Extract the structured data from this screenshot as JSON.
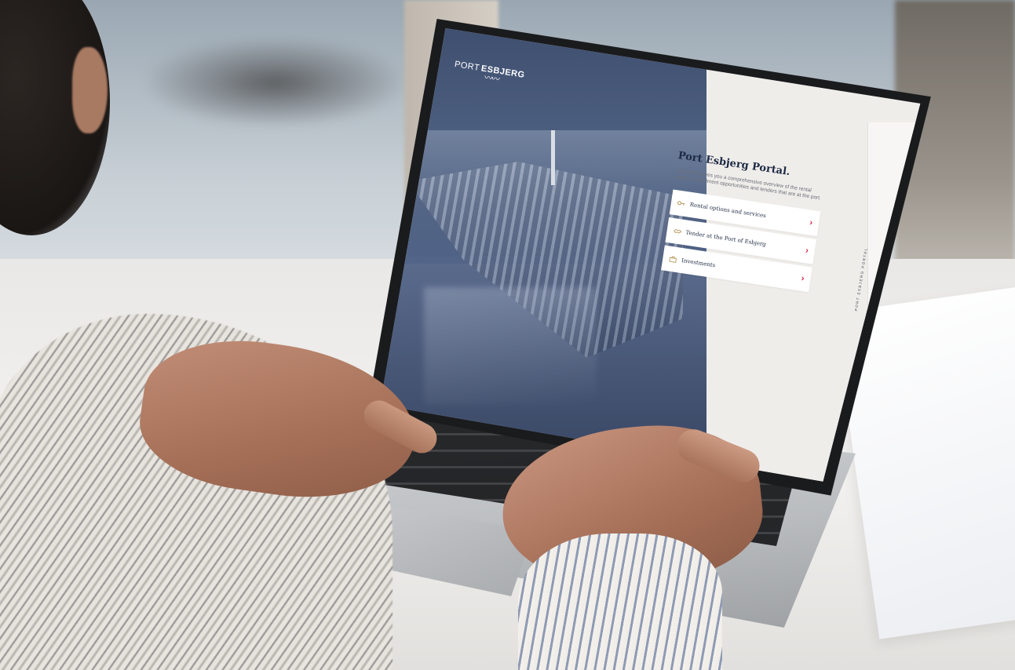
{
  "brand": {
    "word_light": "PORT",
    "word_bold": "ESBJERG"
  },
  "portal": {
    "title": "Port Esbjerg Portal.",
    "description": "This portal gives you a comprehensive overview of the rental options, investment opportunities and tenders that are at the port."
  },
  "menu": {
    "items": [
      {
        "label": "Rental options and services",
        "icon": "key-icon"
      },
      {
        "label": "Tender at the Port of Esbjerg",
        "icon": "handshake-icon"
      },
      {
        "label": "Investments",
        "icon": "briefcase-icon"
      }
    ],
    "chevron": "›"
  },
  "side_label": "PORT ESBJERG PORTAL",
  "colors": {
    "hero_blue": "#4a5b7d",
    "accent_red": "#d7264a",
    "icon_gold": "#b8975a",
    "title_navy": "#1d2a44",
    "panel_bg": "#efedea"
  }
}
